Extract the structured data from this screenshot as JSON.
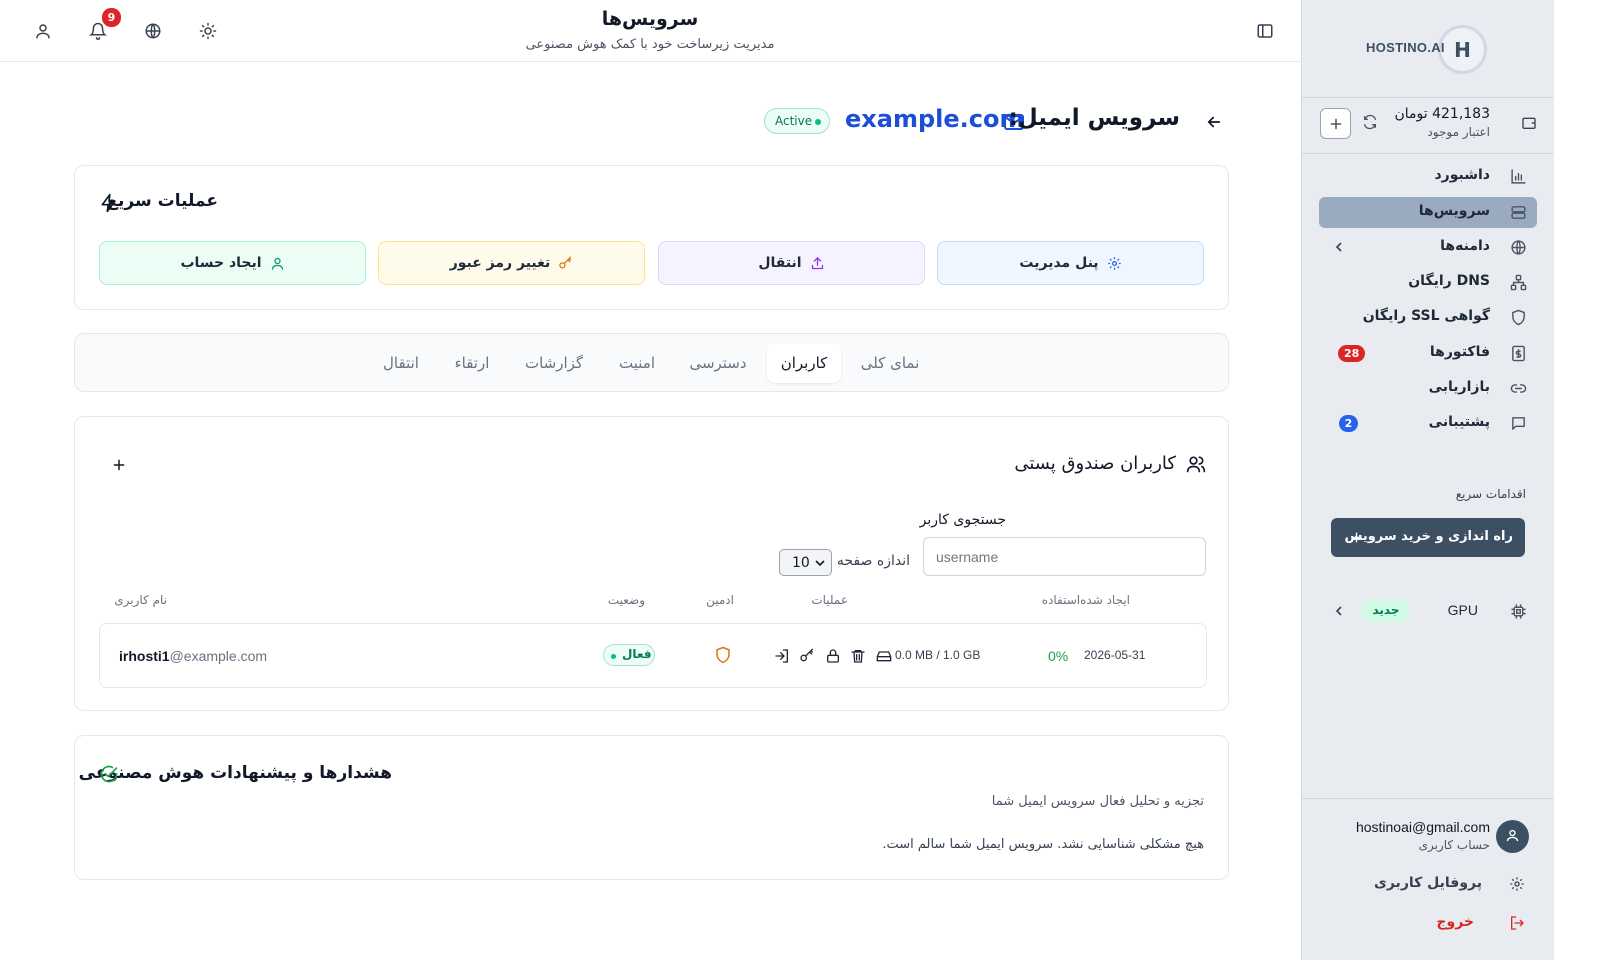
{
  "sidebar": {
    "brand": "HOSTINO.AI",
    "logo_letter": "H",
    "balance": {
      "amount": "421,183 تومان",
      "label": "اعتبار موجود"
    },
    "nav": [
      {
        "label": "داشبورد",
        "icon": "bar-chart-icon"
      },
      {
        "label": "سرویس‌ها",
        "icon": "server-icon",
        "active": true
      },
      {
        "label": "دامنه‌ها",
        "icon": "globe-icon"
      },
      {
        "label": "DNS رایگان",
        "icon": "network-icon"
      },
      {
        "label": "گواهی SSL رایگان",
        "icon": "shield-icon"
      },
      {
        "label": "فاکتورها",
        "icon": "invoice-icon",
        "badge": "28"
      },
      {
        "label": "بازاریابی",
        "icon": "link-icon"
      },
      {
        "label": "پشتیبانی",
        "icon": "message-icon",
        "badge": "2"
      }
    ],
    "quick_actions_title": "اقدامات سریع",
    "quick_action_button": "راه اندازی و خرید سرویس",
    "gpu": {
      "label": "GPU",
      "badge": "جدید"
    },
    "user": {
      "email": "hostinoai@gmail.com",
      "role": "حساب کاربری"
    },
    "profile_label": "پروفایل کاربری",
    "logout_label": "خروج",
    "colors": {
      "badge_red": "#dc2626",
      "badge_blue": "#2563eb",
      "active_bg": "#9aabbf",
      "button_bg": "#3d4f63"
    }
  },
  "header": {
    "title": "سرویس‌ها",
    "subtitle": "مدیریت زیرساخت خود با کمک هوش مصنوعی",
    "notification_count": "9"
  },
  "page": {
    "title_prefix": "سرویس ایمیل:",
    "domain": "example.com",
    "status": "Active"
  },
  "quick_ops": {
    "title": "عملیات سریع",
    "buttons": [
      {
        "label": "پنل مدیریت",
        "icon": "gear-icon"
      },
      {
        "label": "انتقال",
        "icon": "upload-icon"
      },
      {
        "label": "تغییر رمز عبور",
        "icon": "key-icon"
      },
      {
        "label": "ایجاد حساب",
        "icon": "user-icon"
      }
    ]
  },
  "tabs": [
    "نمای کلی",
    "کاربران",
    "دسترسی",
    "امنیت",
    "گزارشات",
    "ارتقاء",
    "انتقال"
  ],
  "active_tab": "کاربران",
  "users_section": {
    "title": "کاربران صندوق پستی",
    "search_label": "جستجوی کاربر",
    "search_placeholder": "username",
    "page_size_label": "اندازه صفحه",
    "page_size": "10",
    "columns": {
      "created_usage": "ایجاد شده‌استفاده",
      "actions": "عملیات",
      "admin": "ادمین",
      "status": "وضعیت",
      "username": "نام کاربری"
    },
    "rows": [
      {
        "created": "2026-05-31",
        "usage_percent": "0%",
        "usage": "0.0 MB / 1.0 GB",
        "status": "فعال",
        "user": "irhosti1",
        "domain": "@example.com"
      }
    ]
  },
  "ai_section": {
    "title": "هشدارها و پیشنهادات هوش مصنوعی",
    "line1": "تجزیه و تحلیل فعال سرویس ایمیل شما",
    "line2": "هیچ مشکلی شناسایی نشد. سرویس ایمیل شما سالم است."
  }
}
